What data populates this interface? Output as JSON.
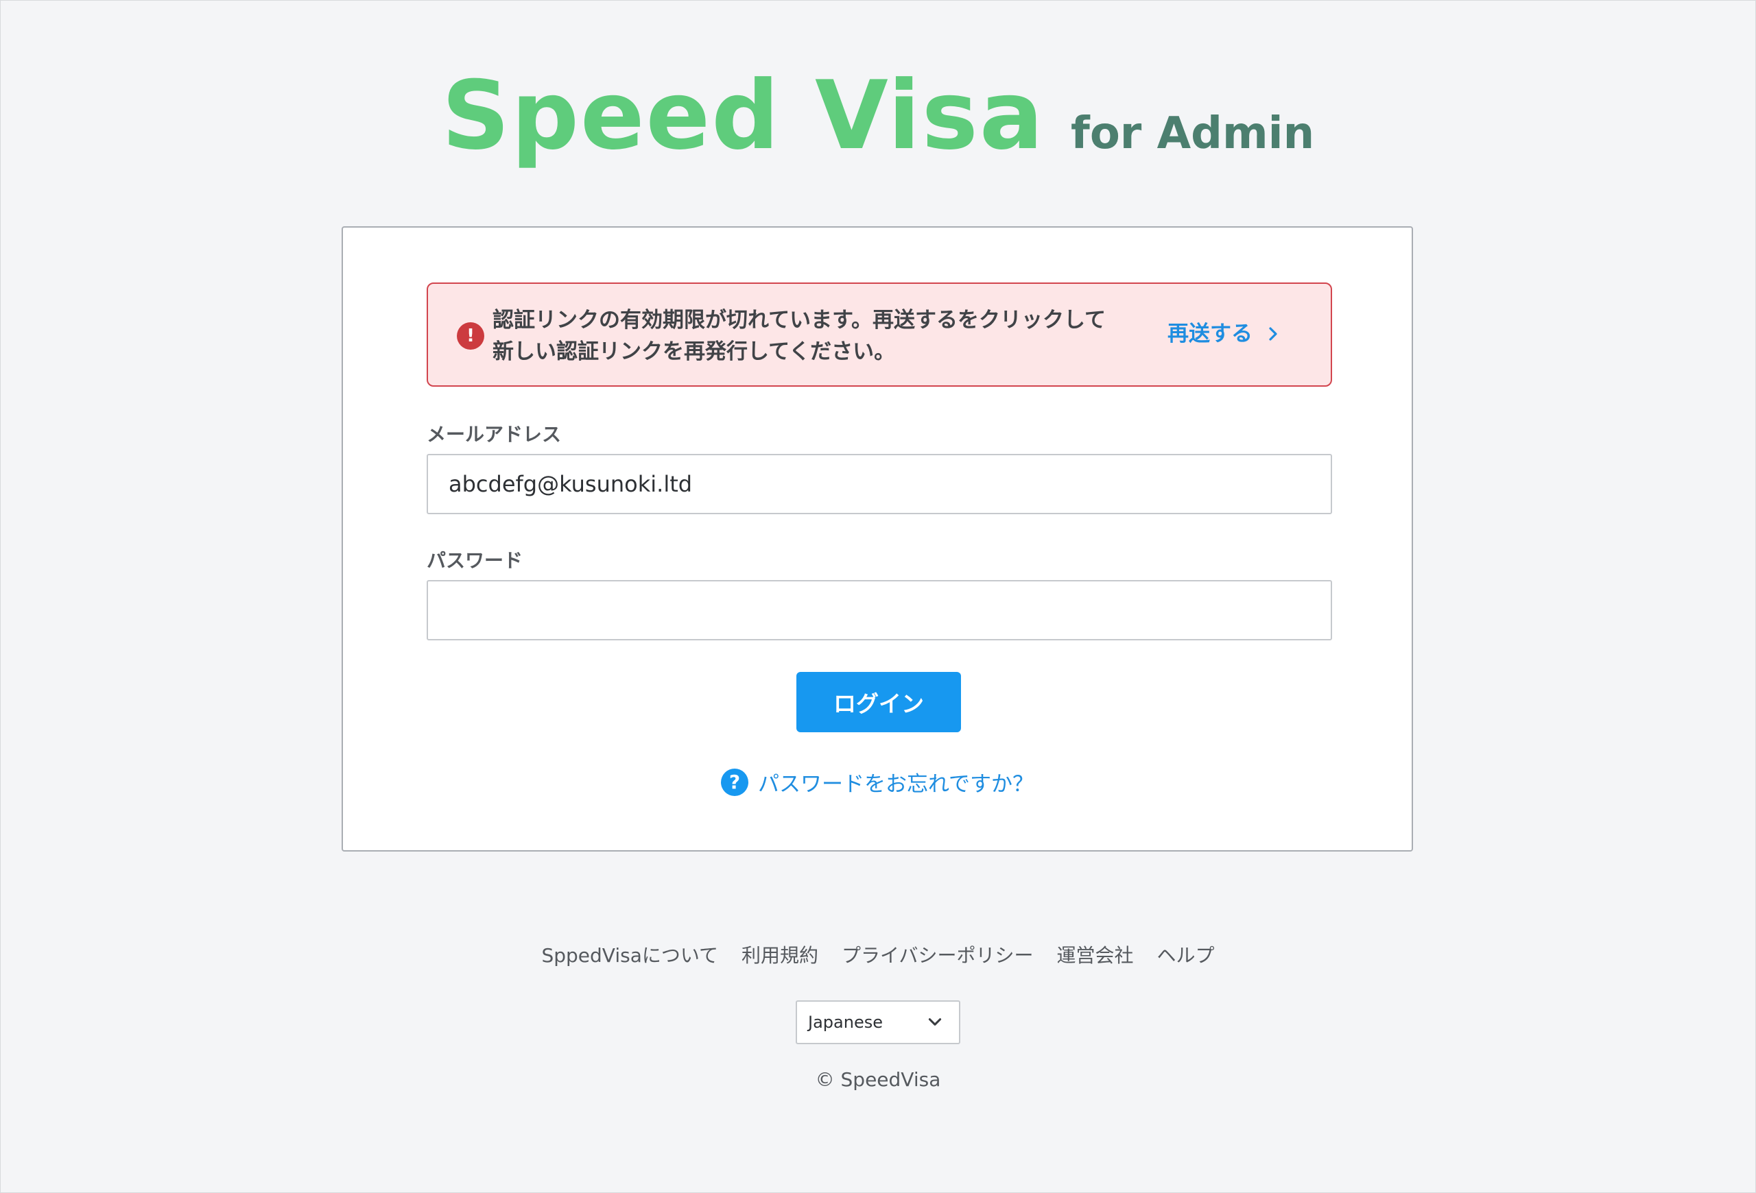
{
  "logo": {
    "main": "Speed Visa",
    "sub": "for Admin"
  },
  "alert": {
    "line1": "認証リンクの有効期限が切れています。再送するをクリックして",
    "line2": "新しい認証リンクを再発行してください。",
    "action_label": "再送する",
    "icon": "exclamation-circle-icon"
  },
  "form": {
    "email_label": "メールアドレス",
    "email_value": "abcdefg@kusunoki.ltd",
    "password_label": "パスワード",
    "password_value": "",
    "login_label": "ログイン",
    "forgot_label": "パスワードをお忘れですか？"
  },
  "footer": {
    "links": [
      "SppedVisaについて",
      "利用規約",
      "プライバシーポリシー",
      "運営会社",
      "ヘルプ"
    ],
    "language": "Japanese",
    "copyright": "© SpeedVisa"
  },
  "colors": {
    "brand_green": "#5fcc7c",
    "brand_dark": "#4c7f6f",
    "accent_blue": "#1798f0",
    "alert_red": "#d2454e",
    "alert_bg": "#fde6e7"
  }
}
